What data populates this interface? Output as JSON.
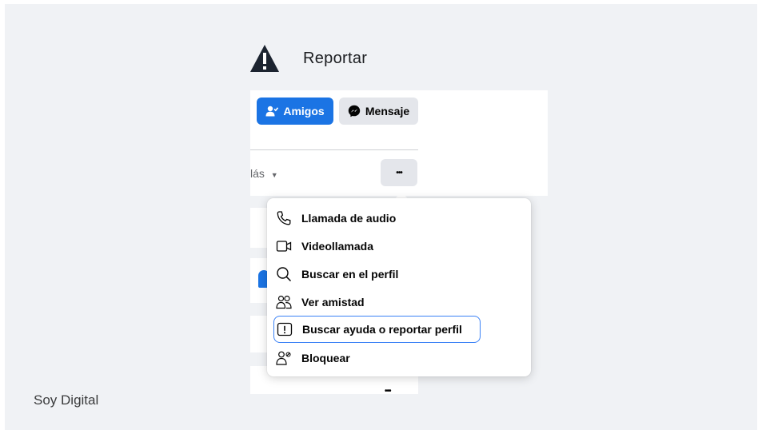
{
  "header": {
    "title": "Reportar",
    "icon": "warning-icon"
  },
  "footer": {
    "brand": "Soy Digital"
  },
  "profile": {
    "friends_label": "Amigos",
    "message_label": "Mensaje",
    "more_tabs_label": "lás",
    "more_options_label": "•••",
    "bottom_more_label": "•••"
  },
  "menu": {
    "items": [
      {
        "label": "Llamada de audio",
        "icon": "phone-icon"
      },
      {
        "label": "Videollamada",
        "icon": "video-camera-icon"
      },
      {
        "label": "Buscar en el perfil",
        "icon": "search-icon"
      },
      {
        "label": "Ver amistad",
        "icon": "friends-icon"
      },
      {
        "label": "Buscar ayuda o reportar perfil",
        "icon": "report-icon",
        "highlighted": true
      },
      {
        "label": "Bloquear",
        "icon": "block-user-icon"
      }
    ]
  },
  "colors": {
    "accent": "#1b74e4",
    "highlight_border": "#3b82f6",
    "background": "#f0f2f5"
  }
}
